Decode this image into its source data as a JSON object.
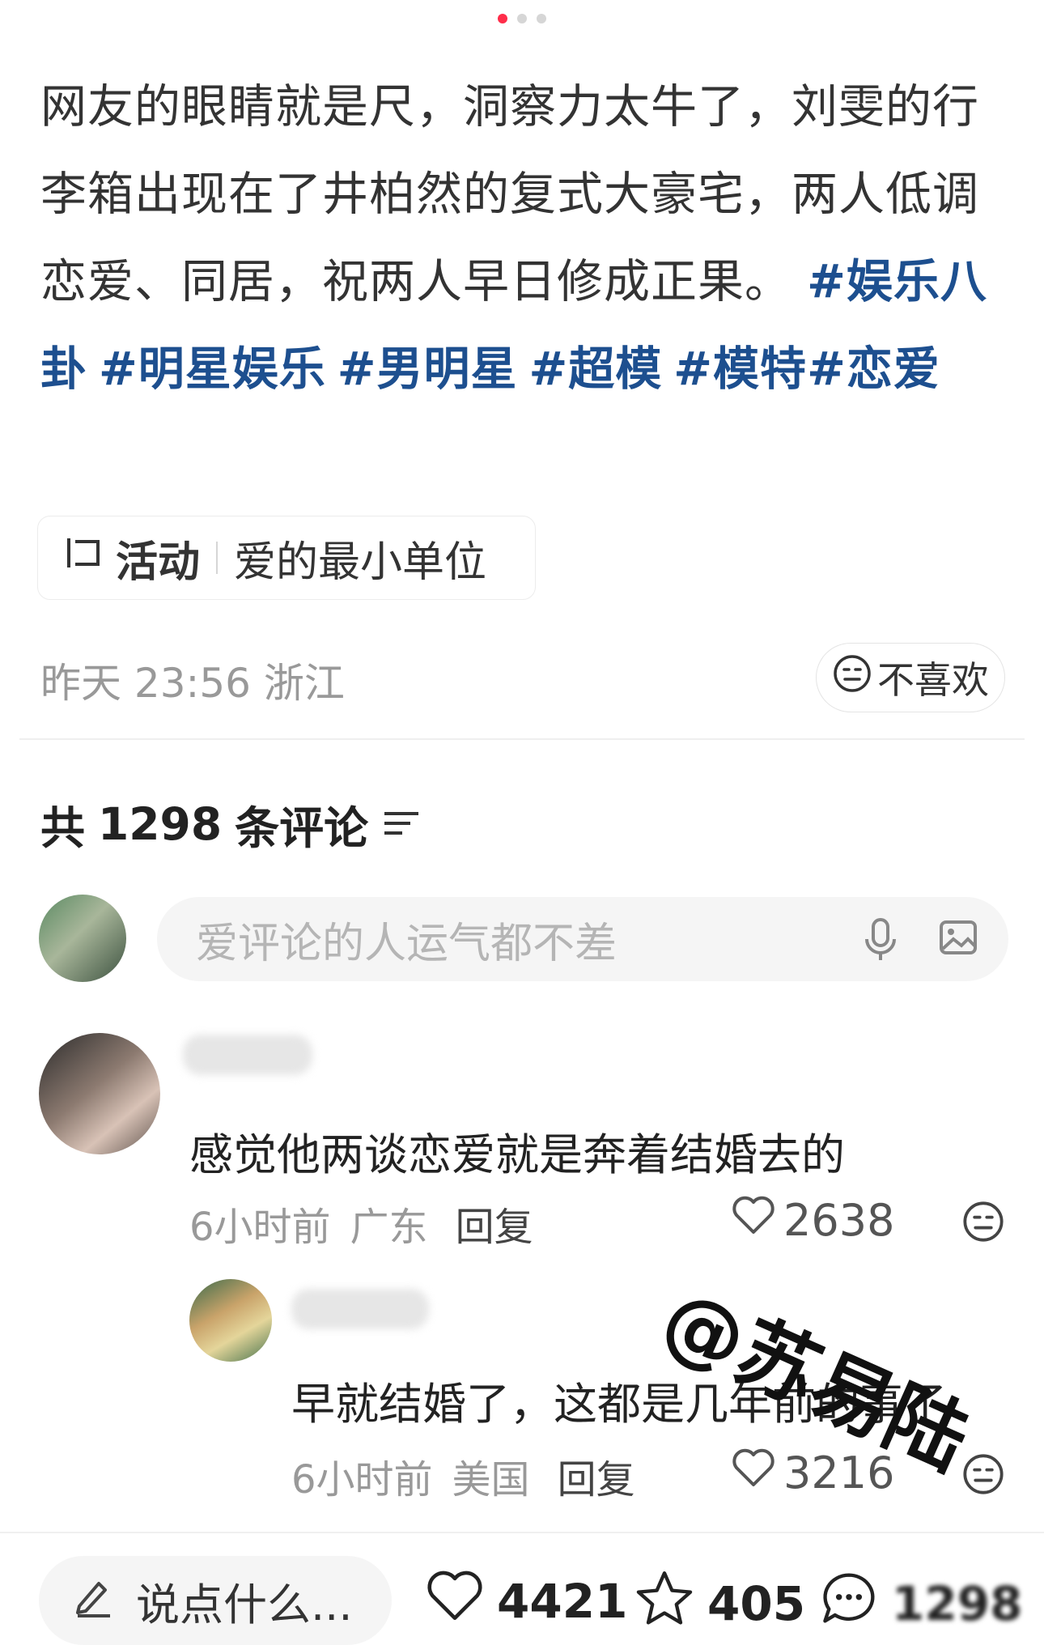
{
  "pager": {
    "count": 3,
    "active_index": 0
  },
  "post": {
    "text": "网友的眼睛就是尺，洞察力太牛了，刘雯的行李箱出现在了井柏然的复式大豪宅，两人低调恋爱、同居，祝两人早日修成正果。",
    "tags": [
      "#娱乐八卦",
      "#明星娱乐",
      "#男明星",
      "#超模",
      "#模特",
      "#恋爱"
    ]
  },
  "activity": {
    "kind": "活动",
    "title": "爱的最小单位"
  },
  "meta": {
    "time": "昨天 23:56",
    "location": "浙江"
  },
  "dislike_label": "不喜欢",
  "comments_header": {
    "prefix": "共",
    "count": "1298",
    "suffix": "条评论"
  },
  "comment_input": {
    "placeholder": "爱评论的人运气都不差"
  },
  "comments": [
    {
      "text": "感觉他两谈恋爱就是奔着结婚去的",
      "time": "6小时前",
      "location": "广东",
      "reply_label": "回复",
      "likes": "2638",
      "replies": [
        {
          "text": "早就结婚了，这都是几年前的事了",
          "time": "6小时前",
          "location": "美国",
          "reply_label": "回复",
          "likes": "3216"
        }
      ]
    }
  ],
  "watermark": "@苏易陆",
  "bottom_bar": {
    "say_placeholder": "说点什么...",
    "likes": "4421",
    "stars": "405",
    "comments": "1298"
  },
  "icons": [
    "activity-icon",
    "dislike-face-icon",
    "sort-icon",
    "mic-icon",
    "image-icon",
    "heart-icon",
    "star-icon",
    "comment-bubble-icon",
    "pencil-icon"
  ]
}
